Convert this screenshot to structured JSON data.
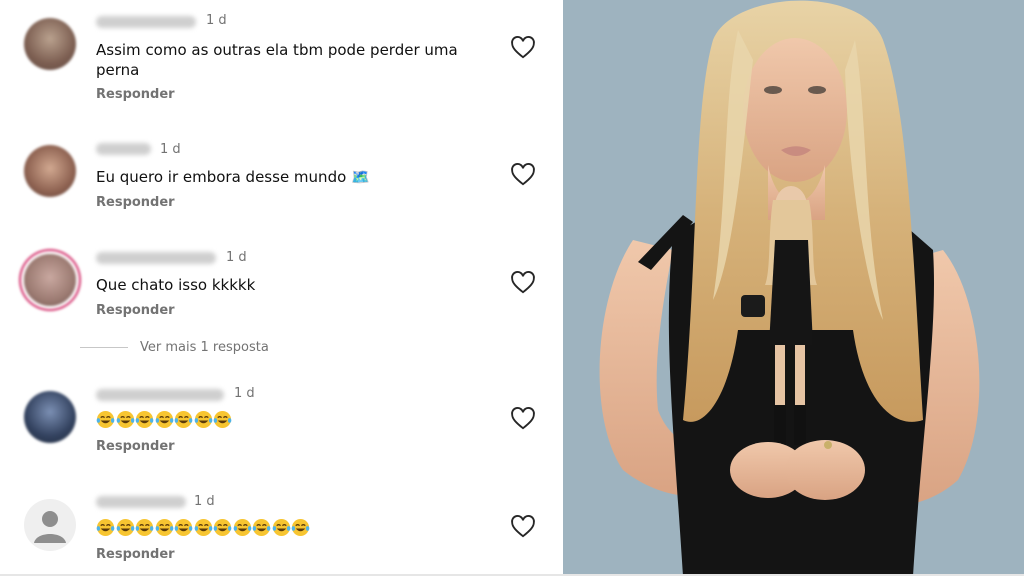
{
  "comments": [
    {
      "time": "1 d",
      "text": "Assim como as outras ela tbm pode perder uma perna",
      "reply": "Responder"
    },
    {
      "time": "1 d",
      "text": "Eu quero ir embora desse mundo 🗺️",
      "reply": "Responder"
    },
    {
      "time": "1 d",
      "text": "Que chato isso kkkkk",
      "reply": "Responder"
    },
    {
      "time": "1 d",
      "text": "😂😂😂😂😂😂😂",
      "reply": "Responder"
    },
    {
      "time": "1 d",
      "text": "😂😂😂😂😂😂😂😂😂😂😂",
      "reply": "Responder"
    }
  ],
  "view_more": "Ver mais 1 resposta",
  "icons": {
    "like": "heart-outline-icon",
    "default_avatar": "default-user-avatar-icon"
  },
  "photo": {
    "description_icon": "woman-holding-doll-photo"
  },
  "colors": {
    "meta_text": "#737373",
    "story_ring": "#d3336d",
    "photo_bg": "#9eb3bf"
  }
}
